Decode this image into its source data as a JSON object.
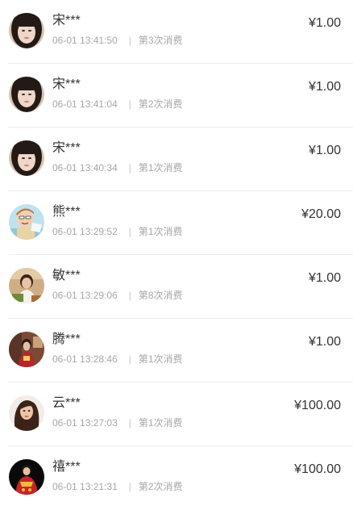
{
  "records": [
    {
      "name": "宋***",
      "time": "06-01 13:41:50",
      "separator": "|",
      "visit": "第3次消费",
      "amount": "¥1.00",
      "avatar": "avatar-woman-dark-hair"
    },
    {
      "name": "宋***",
      "time": "06-01 13:41:04",
      "separator": "|",
      "visit": "第2次消费",
      "amount": "¥1.00",
      "avatar": "avatar-woman-dark-hair"
    },
    {
      "name": "宋***",
      "time": "06-01 13:40:34",
      "separator": "|",
      "visit": "第1次消费",
      "amount": "¥1.00",
      "avatar": "avatar-woman-dark-hair"
    },
    {
      "name": "熊***",
      "time": "06-01 13:29:52",
      "separator": "|",
      "visit": "第1次消费",
      "amount": "¥20.00",
      "avatar": "avatar-cartoon-boy"
    },
    {
      "name": "敏***",
      "time": "06-01 13:29:06",
      "separator": "|",
      "visit": "第8次消费",
      "amount": "¥1.00",
      "avatar": "avatar-woman-indoor"
    },
    {
      "name": "腾***",
      "time": "06-01 13:28:46",
      "separator": "|",
      "visit": "第1次消费",
      "amount": "¥1.00",
      "avatar": "avatar-person-room"
    },
    {
      "name": "云***",
      "time": "06-01 13:27:03",
      "separator": "|",
      "visit": "第1次消费",
      "amount": "¥100.00",
      "avatar": "avatar-woman-long-hair"
    },
    {
      "name": "禧***",
      "time": "06-01 13:21:31",
      "separator": "|",
      "visit": "第2次消费",
      "amount": "¥100.00",
      "avatar": "avatar-person-red-costume"
    }
  ]
}
